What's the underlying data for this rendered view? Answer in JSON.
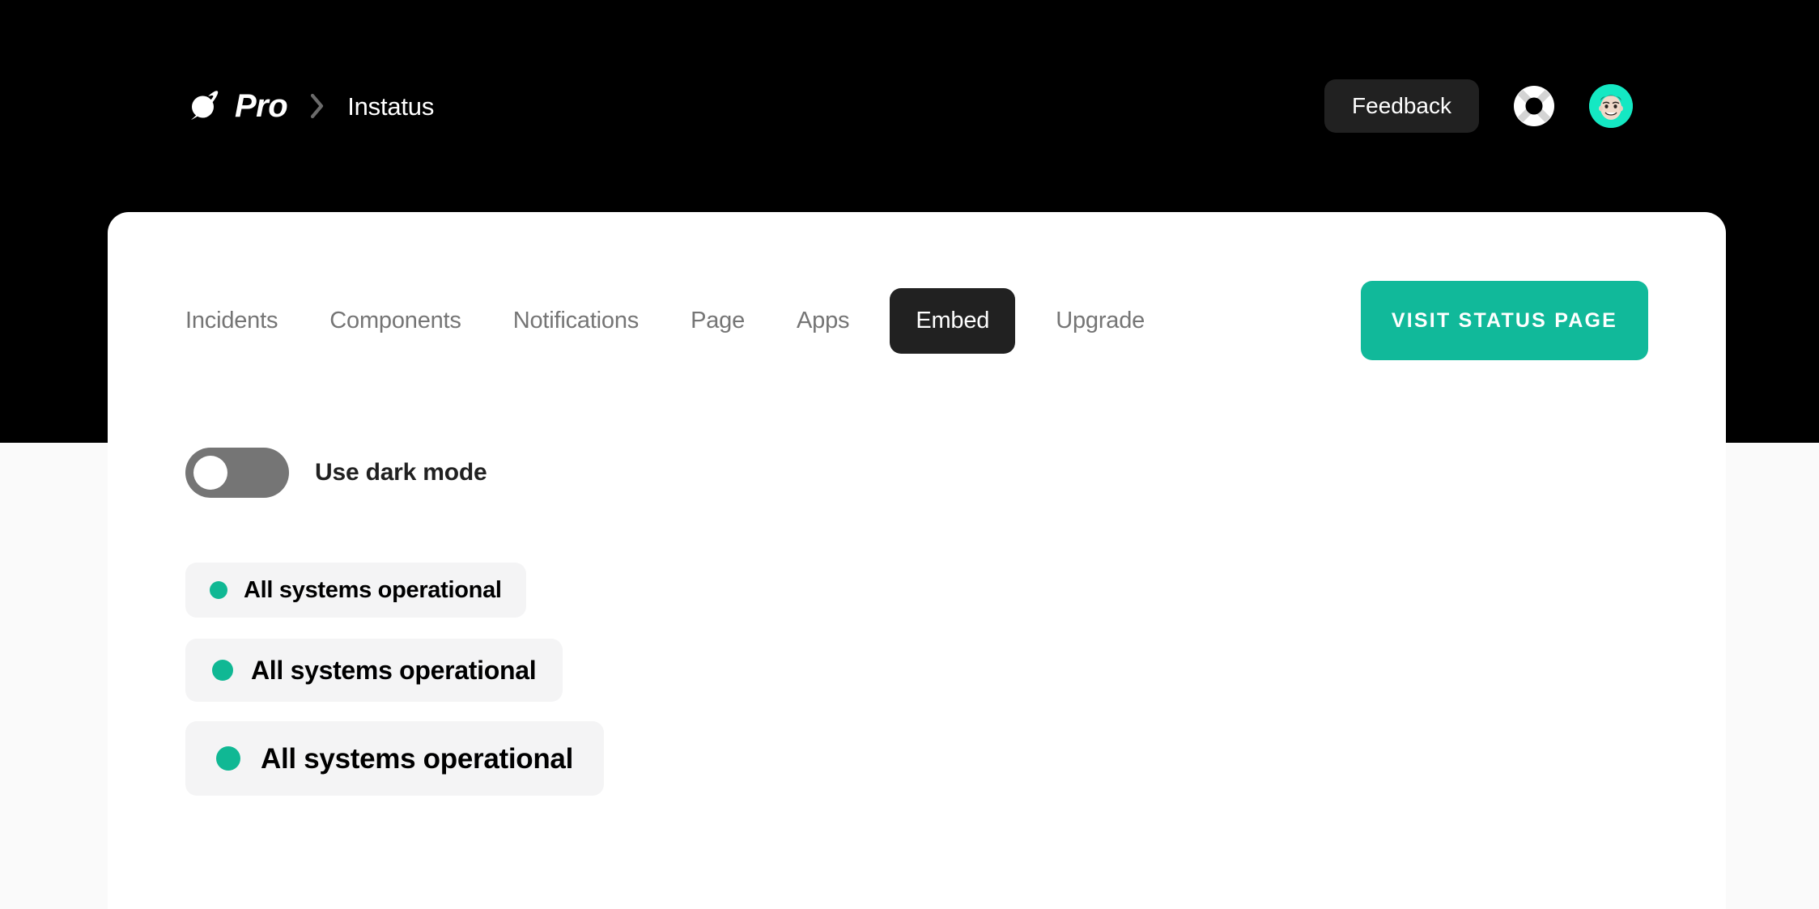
{
  "header": {
    "brand_name": "Pro",
    "brand_icon": "planet-icon",
    "breadcrumb_separator_icon": "chevron-right-icon",
    "breadcrumb_current": "Instatus",
    "feedback_label": "Feedback",
    "help_icon": "life-ring-icon",
    "avatar_icon": "user-avatar-memoji",
    "avatar_bg_color": "#14e8c3",
    "background_color": "#000000"
  },
  "nav": {
    "items": [
      {
        "label": "Incidents",
        "active": false
      },
      {
        "label": "Components",
        "active": false
      },
      {
        "label": "Notifications",
        "active": false
      },
      {
        "label": "Page",
        "active": false
      },
      {
        "label": "Apps",
        "active": false
      },
      {
        "label": "Embed",
        "active": true
      },
      {
        "label": "Upgrade",
        "active": false
      }
    ],
    "cta_label": "VISIT STATUS PAGE",
    "cta_color": "#11b99a",
    "active_tab_color": "#212121",
    "inactive_tab_color": "#757575"
  },
  "settings": {
    "dark_mode_label": "Use dark mode",
    "dark_mode_enabled": false,
    "toggle_track_color": "#757575",
    "toggle_knob_color": "#ffffff"
  },
  "badges": {
    "status_color": "#10b894",
    "background_color": "#f4f4f5",
    "items": [
      {
        "label": "All systems operational",
        "size": "sz-sm"
      },
      {
        "label": "All systems operational",
        "size": "sz-md"
      },
      {
        "label": "All systems operational",
        "size": "sz-lg"
      }
    ]
  },
  "page": {
    "card_background": "#ffffff",
    "page_background": "#fafafa"
  }
}
